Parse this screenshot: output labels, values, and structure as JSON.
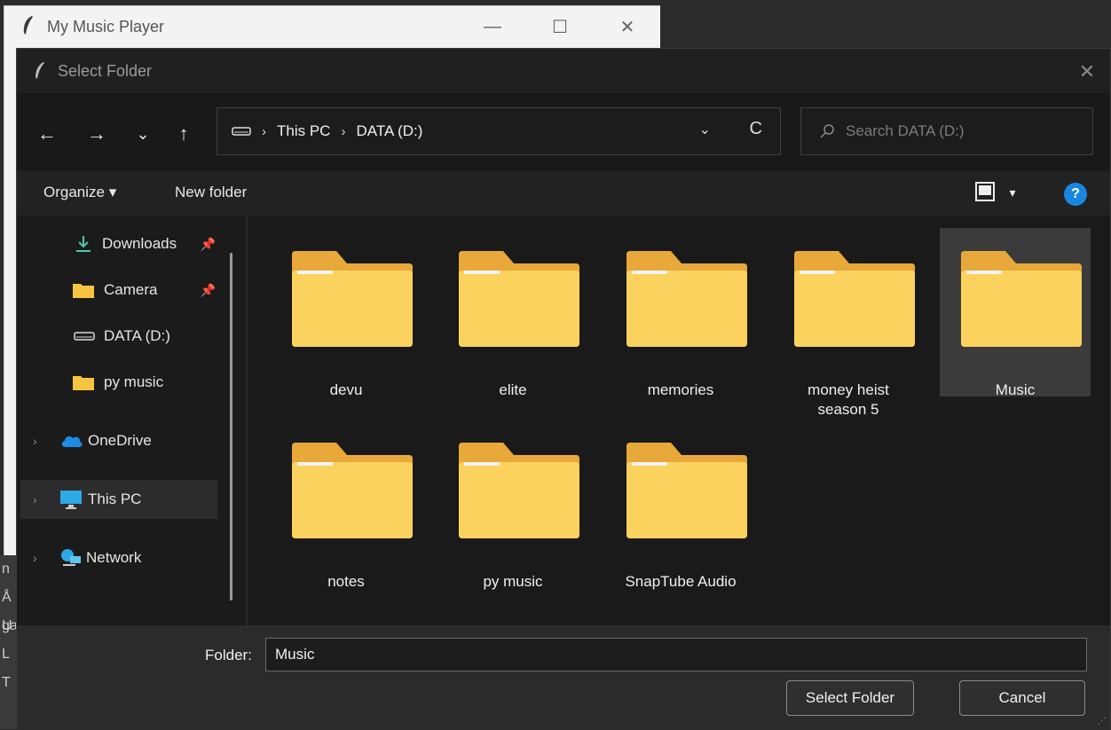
{
  "background_app": {
    "title": "My Music Player",
    "controls": {
      "minimize": "—",
      "maximize": "☐",
      "close": "✕"
    },
    "partial_text": [
      "n",
      "Å U",
      "ga",
      "L T"
    ]
  },
  "dialog": {
    "title": "Select Folder",
    "close": "✕"
  },
  "nav": {
    "back": "←",
    "forward": "→",
    "recent": "⌄",
    "up": "↑",
    "breadcrumb": [
      "This PC",
      "DATA (D:)"
    ],
    "separator": "›",
    "address_dropdown": "⌄",
    "refresh": "C"
  },
  "search": {
    "placeholder": "Search DATA (D:)"
  },
  "toolbar": {
    "organize_label": "Organize ▾",
    "new_folder_label": "New folder",
    "view_dropdown": "▾",
    "help": "?"
  },
  "sidebar": {
    "items": [
      {
        "label": "Downloads",
        "icon": "download-icon",
        "pinned": true,
        "pin": "📌"
      },
      {
        "label": "Camera",
        "icon": "folder-icon",
        "pinned": true,
        "pin": "📌"
      },
      {
        "label": "DATA (D:)",
        "icon": "drive-icon"
      },
      {
        "label": "py music",
        "icon": "folder-icon"
      },
      {
        "label": "OneDrive",
        "icon": "cloud-icon",
        "expand": "›"
      },
      {
        "label": "This PC",
        "icon": "monitor-icon",
        "expand": "›",
        "selected": true
      },
      {
        "label": "Network",
        "icon": "network-icon",
        "expand": "›"
      }
    ]
  },
  "files": [
    {
      "name": "devu"
    },
    {
      "name": "elite"
    },
    {
      "name": "memories"
    },
    {
      "name": "money heist season 5"
    },
    {
      "name": "Music",
      "selected": true
    },
    {
      "name": "notes"
    },
    {
      "name": "py music"
    },
    {
      "name": "SnapTube Audio"
    }
  ],
  "footer": {
    "folder_label": "Folder:",
    "folder_value": "Music",
    "select_button": "Select Folder",
    "cancel_button": "Cancel"
  },
  "colors": {
    "dialog_bg": "#1f1f1f",
    "folder_yellow": "#fcd25f",
    "accent_blue": "#1a86e0"
  }
}
